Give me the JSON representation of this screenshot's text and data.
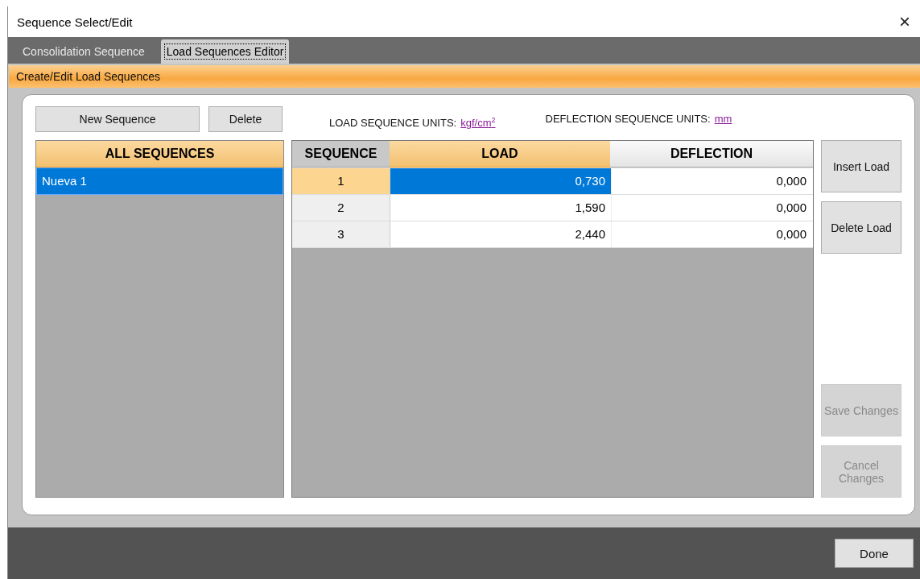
{
  "window": {
    "title": "Sequence Select/Edit",
    "close": "×"
  },
  "tabs": [
    {
      "label": "Consolidation Sequence",
      "selected": false
    },
    {
      "label": "Load Sequences Editor",
      "selected": true
    }
  ],
  "section_header": "Create/Edit Load Sequences",
  "list_buttons": [
    {
      "label": "New Sequence",
      "disabled": false
    },
    {
      "label": "Delete",
      "disabled": false
    }
  ],
  "units": [
    {
      "label": "LOAD SEQUENCE UNITS:",
      "value": "kgf/cm$^{2}$"
    },
    {
      "label": "DEFLECTION SEQUENCE UNITS:",
      "value": "mm"
    }
  ],
  "sequences": {
    "header": "ALL SEQUENCES",
    "items": [
      {
        "name": "Nueva 1",
        "selected": true
      }
    ]
  },
  "table": {
    "columns": [
      "SEQUENCE",
      "LOAD",
      "DEFLECTION"
    ],
    "rows": [
      {
        "cells": [
          "1",
          "0,730",
          "0,000"
        ],
        "selected": true
      },
      {
        "cells": [
          "2",
          "1,590",
          "0,000"
        ],
        "selected": false
      },
      {
        "cells": [
          "3",
          "2,440",
          "0,000"
        ],
        "selected": false
      }
    ]
  },
  "side_buttons": [
    {
      "label": "Insert Load",
      "disabled": false
    },
    {
      "label": "Delete Load",
      "disabled": false
    },
    {
      "label": "Save Changes",
      "disabled": true
    },
    {
      "label": "Cancel Changes",
      "disabled": true
    }
  ],
  "done_button": "Done"
}
